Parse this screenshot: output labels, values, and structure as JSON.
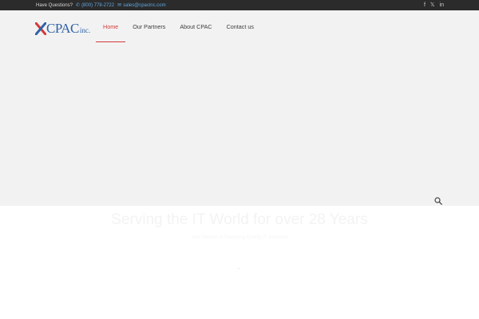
{
  "topbar": {
    "question": "Have Questions?",
    "phone_icon": "phone-icon",
    "phone": "(800) 778-2722",
    "mail_icon": "mail-icon",
    "email": "sales@cpacinc.com",
    "social": [
      {
        "icon": "facebook-icon",
        "glyph": "f"
      },
      {
        "icon": "x-twitter-icon",
        "glyph": "𝕏"
      },
      {
        "icon": "linkedin-icon",
        "glyph": "in"
      }
    ]
  },
  "logo": {
    "brand": "CPAC",
    "suffix": "inc.",
    "colors": {
      "blue": "#2f63a7",
      "red": "#d43a3a"
    }
  },
  "nav": {
    "items": [
      {
        "label": "Home",
        "active": true
      },
      {
        "label": "Our Partners",
        "active": false
      },
      {
        "label": "About CPAC",
        "active": false
      },
      {
        "label": "Contact us",
        "active": false
      }
    ],
    "accent": "#d43a3a"
  },
  "hero": {
    "headline": "Serving the IT World for over 28 Years",
    "subline": "Your Partner in Supplying Quality IT Solutions"
  }
}
